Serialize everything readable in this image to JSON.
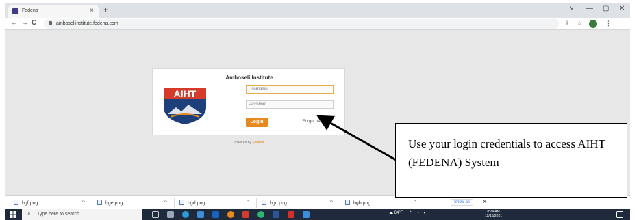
{
  "browser": {
    "tab_title": "Fedena",
    "tab_close": "×",
    "new_tab": "+",
    "controls": [
      "˅",
      "—",
      "▢",
      "✕"
    ],
    "nav": {
      "back": "←",
      "forward": "→",
      "reload": "C"
    },
    "url": "amboseliinstitute.fedena.com",
    "bar_icons": [
      "⇪",
      "☆",
      "⋮"
    ]
  },
  "login": {
    "title": "Amboseli Institute",
    "logo_text": "AIHT",
    "username_placeholder": "Username",
    "password_placeholder": "Password",
    "login_button": "Login",
    "forgot_password": "Forgot pas",
    "powered_by": "Powered by",
    "powered_brand": "Fedena"
  },
  "downloads": {
    "items": [
      "bgf.png",
      "bge.png",
      "bgd.png",
      "bgc.png",
      "bgb.png"
    ],
    "chevron": "^",
    "show_all": "Show all",
    "close": "✕"
  },
  "taskbar": {
    "search_placeholder": "Type here to search",
    "weather": "64°F",
    "time": "8:24 AM",
    "date": "12/18/2021"
  },
  "annotation": {
    "text": "Use your login credentials to access AIHT (FEDENA) System"
  },
  "colors": {
    "accent_orange": "#e8891f",
    "logo_blue": "#1d3f7a",
    "logo_red": "#d53b2b",
    "taskbar": "#1f2b3c"
  }
}
